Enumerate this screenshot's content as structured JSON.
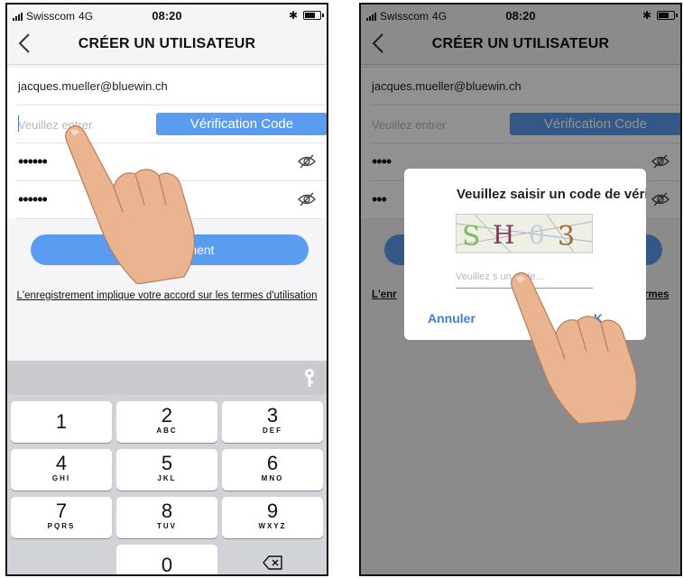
{
  "status_bar": {
    "carrier": "Swisscom",
    "network": "4G",
    "time": "08:20",
    "bluetooth": "✱"
  },
  "header": {
    "back_icon": "chevron-left-icon",
    "title": "CRÉER UN UTILISATEUR"
  },
  "form": {
    "email": "jacques.mueller@bluewin.ch",
    "code_placeholder": "Veuillez entrer",
    "verification_button": "Vérification Code",
    "password_mask": "••••••",
    "confirm_mask": "••••••",
    "eye_icon": "eye-off-icon"
  },
  "register_button": "rement",
  "terms_text": "L'enregistrement implique votre accord sur les termes d'utilisation",
  "keyboard": {
    "keys": [
      {
        "num": "1",
        "letters": ""
      },
      {
        "num": "2",
        "letters": "ABC"
      },
      {
        "num": "3",
        "letters": "DEF"
      },
      {
        "num": "4",
        "letters": "GHI"
      },
      {
        "num": "5",
        "letters": "JKL"
      },
      {
        "num": "6",
        "letters": "MNO"
      },
      {
        "num": "7",
        "letters": "PQRS"
      },
      {
        "num": "8",
        "letters": "TUV"
      },
      {
        "num": "9",
        "letters": "WXYZ"
      },
      {
        "num": "0",
        "letters": ""
      }
    ],
    "key_icon": "key-icon",
    "delete_icon": "backspace-icon"
  },
  "right_screen": {
    "email": "jacques.mueller@bluewin.ch",
    "code_placeholder": "Veuillez entrer",
    "verification_button": "Vérification Code",
    "mask_1": "••••",
    "mask_2": "•••",
    "terms_left": "L'enr",
    "terms_right": "rmes"
  },
  "dialog": {
    "title": "Veuillez saisir un code de vérifica",
    "captcha_chars": "SH03",
    "input_placeholder": "Veuillez s  un code...",
    "cancel_label": "Annuler",
    "ok_label": "K"
  },
  "colors": {
    "accent": "#5a9cf0",
    "link": "#3c7fd8"
  }
}
